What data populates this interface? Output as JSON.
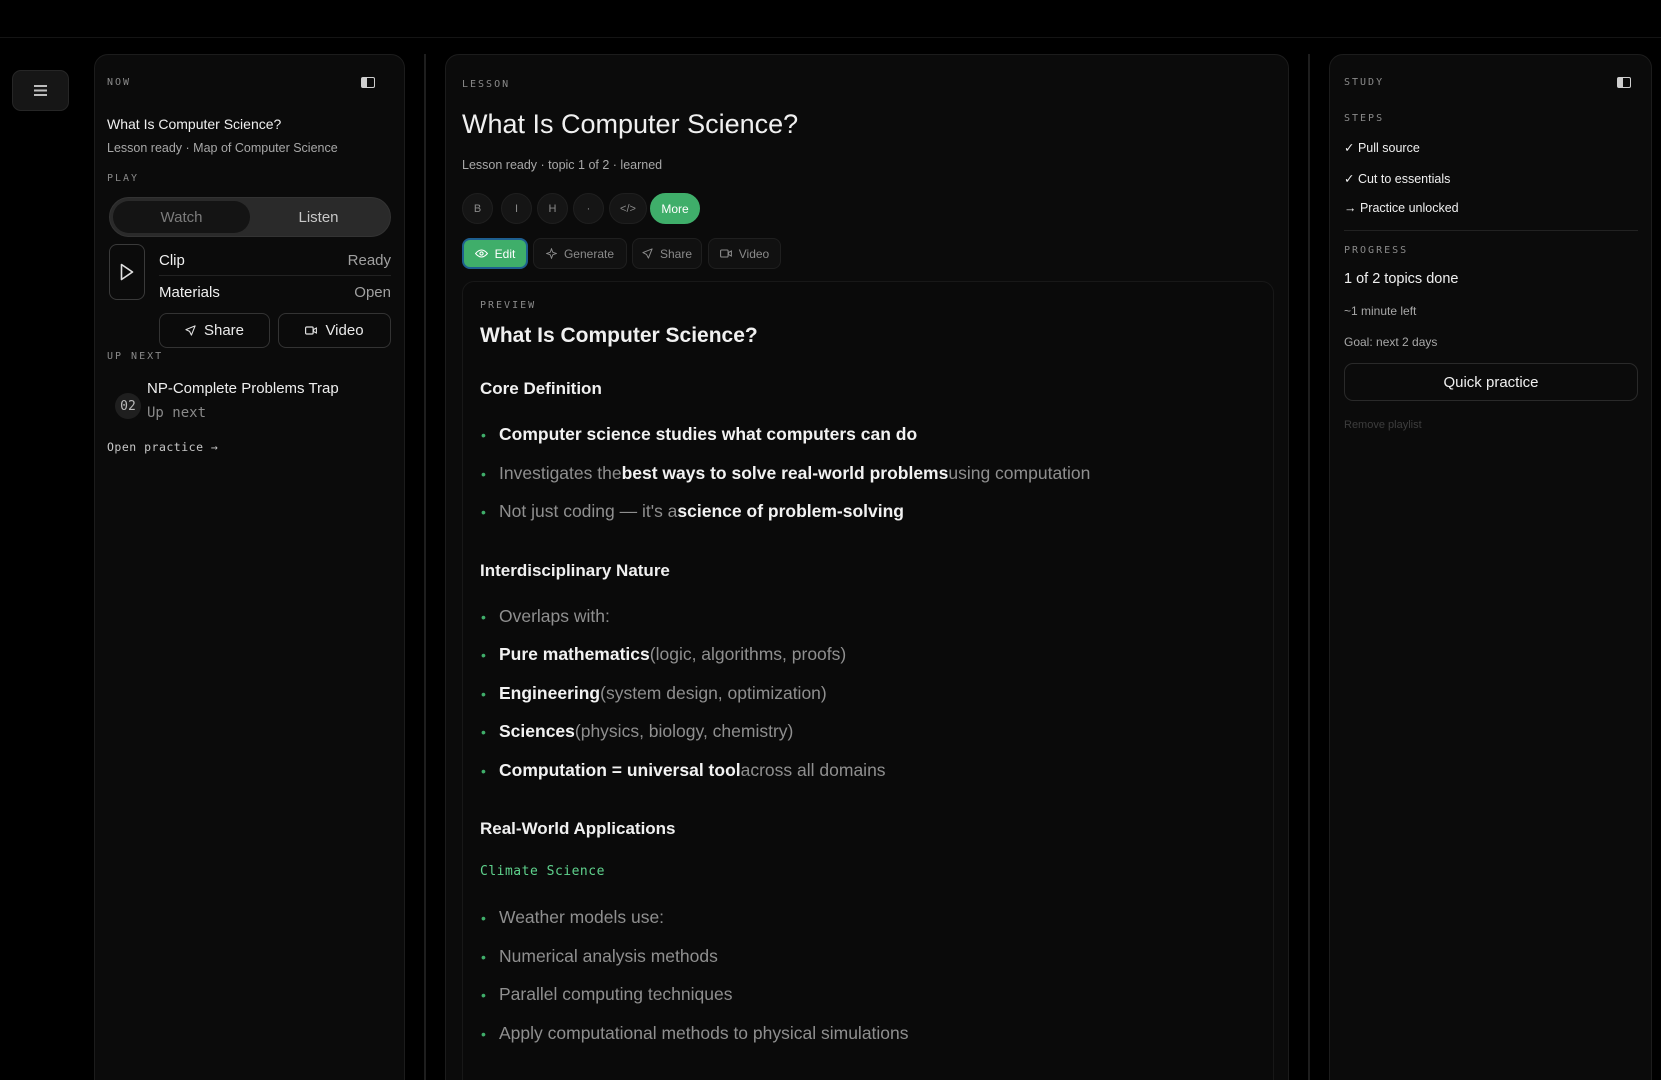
{
  "left": {
    "now_label": "NOW",
    "title": "What Is Computer Science?",
    "subtitle": "Lesson ready · Map of Computer Science",
    "play_label": "PLAY",
    "watch": "Watch",
    "listen": "Listen",
    "rows": [
      {
        "label": "Clip",
        "value": "Ready"
      },
      {
        "label": "Materials",
        "value": "Open"
      }
    ],
    "share": "Share",
    "video": "Video",
    "upnext_label": "UP NEXT",
    "upnext_num": "02",
    "upnext_title": "NP-Complete Problems Trap",
    "upnext_sub": "Up next",
    "open_practice": "Open practice →"
  },
  "center": {
    "lesson_label": "LESSON",
    "title": "What Is Computer Science?",
    "subtitle": "Lesson ready · topic 1 of 2 · learned",
    "format_buttons": [
      "B",
      "I",
      "H",
      "·",
      "</>"
    ],
    "more": "More",
    "actions": {
      "edit": "Edit",
      "generate": "Generate",
      "share": "Share",
      "video": "Video"
    },
    "preview_label": "PREVIEW",
    "preview": {
      "h1": "What Is Computer Science?",
      "sec1": "Core Definition",
      "sec1_items": [
        {
          "pre": "",
          "bold": "Computer science studies what computers can do",
          "post": ""
        },
        {
          "pre": "Investigates the ",
          "bold": "best ways to solve real-world problems",
          "post": " using computation"
        },
        {
          "pre": "Not just coding — it's a ",
          "bold": "science of problem-solving",
          "post": ""
        }
      ],
      "sec2": "Interdisciplinary Nature",
      "sec2_items": [
        {
          "pre": "Overlaps with:",
          "bold": "",
          "post": ""
        },
        {
          "pre": "",
          "bold": "Pure mathematics",
          "post": " (logic, algorithms, proofs)"
        },
        {
          "pre": "",
          "bold": "Engineering",
          "post": " (system design, optimization)"
        },
        {
          "pre": "",
          "bold": "Sciences",
          "post": " (physics, biology, chemistry)"
        },
        {
          "pre": "",
          "bold": "Computation = universal tool",
          "post": " across all domains"
        }
      ],
      "sec3": "Real-World Applications",
      "code_label": "Climate Science",
      "sec3_items": [
        "Weather models use:",
        "Numerical analysis methods",
        "Parallel computing techniques",
        "Apply computational methods to physical simulations"
      ]
    }
  },
  "right": {
    "study_label": "STUDY",
    "steps_label": "STEPS",
    "steps": [
      "✓ Pull source",
      "✓ Cut to essentials",
      "→ Practice unlocked"
    ],
    "progress_label": "PROGRESS",
    "progress_main": "1 of 2 topics done",
    "time_left": "~1 minute left",
    "goal": "Goal: next 2 days",
    "quick_practice": "Quick practice",
    "remove_playlist": "Remove playlist"
  },
  "colors": {
    "accent": "#3fae6a",
    "code": "#5fd28d"
  },
  "icons": [
    "menu-icon",
    "panel-toggle-icon",
    "play-icon",
    "send-icon",
    "video-camera-icon",
    "eye-icon",
    "sparkle-icon"
  ]
}
